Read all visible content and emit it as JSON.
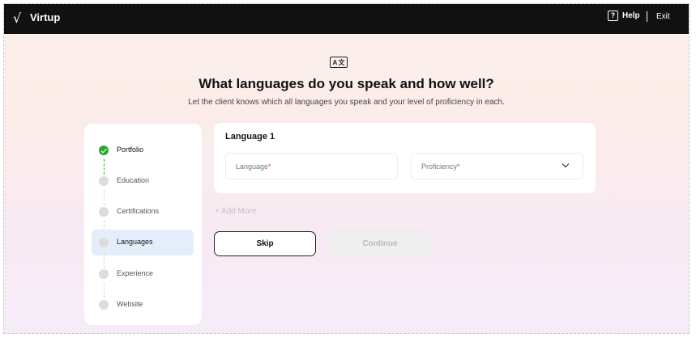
{
  "header": {
    "logo_mark": "√",
    "app_name": "Virtup",
    "help_icon_glyph": "?",
    "help_label": "Help",
    "exit_label": "Exit"
  },
  "page": {
    "icon_glyph_left": "A",
    "icon_glyph_right": "文",
    "title": "What languages do you speak and how well?",
    "subtitle": "Let the client knows which all languages you speak and your level of proficiency in each."
  },
  "steps": [
    {
      "label": "Portfolio",
      "state": "done"
    },
    {
      "label": "Education",
      "state": "pending"
    },
    {
      "label": "Certifications",
      "state": "pending"
    },
    {
      "label": "Languages",
      "state": "active"
    },
    {
      "label": "Experience",
      "state": "pending"
    },
    {
      "label": "Website",
      "state": "pending"
    }
  ],
  "form": {
    "card_title": "Language 1",
    "language_placeholder": "Language",
    "proficiency_placeholder": "Proficiency",
    "required_mark": "*",
    "add_more_label": "+ Add More",
    "skip_label": "Skip",
    "continue_label": "Continue"
  },
  "colors": {
    "topbar": "#111111",
    "done_green": "#2ea52e",
    "active_step_bg": "#e4eefb",
    "required_red": "#e0453a"
  }
}
